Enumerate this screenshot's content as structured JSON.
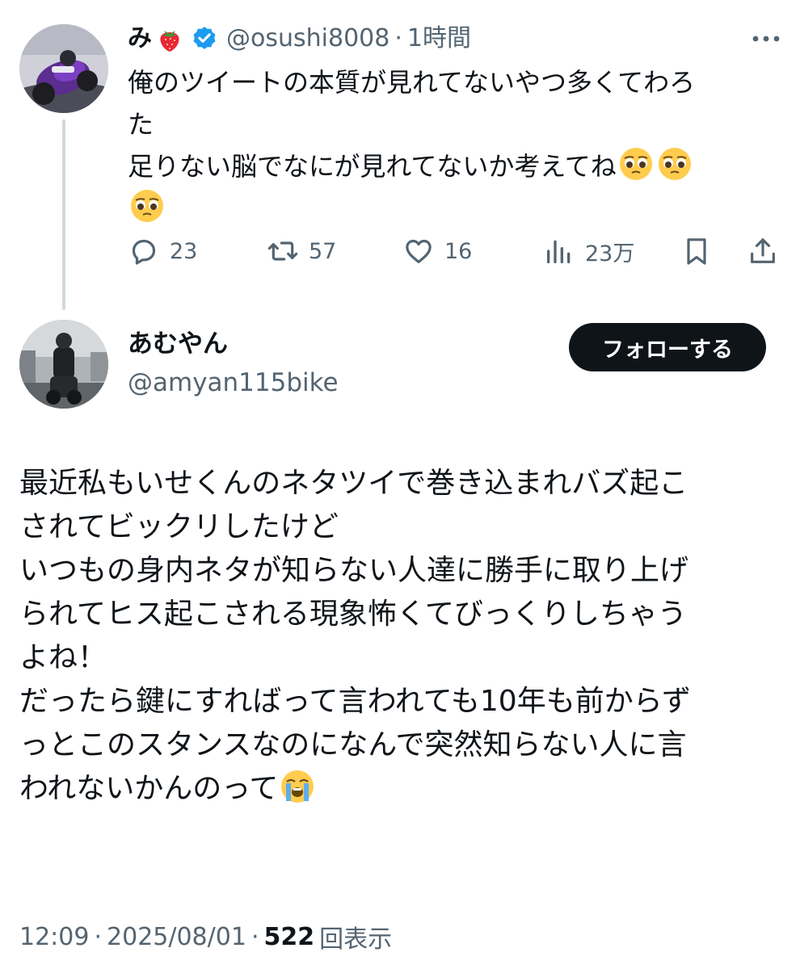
{
  "parent_tweet": {
    "author_name": "み",
    "name_emoji": "strawberry-emoji",
    "verified": true,
    "handle": "@osushi8008",
    "separator": "·",
    "time": "1時間",
    "body_lines": [
      "俺のツイートの本質が見れてないやつ多くてわろ",
      "た",
      "足りない脳でなにが見れてないか考えてね"
    ],
    "body_emoji": "pleading-face-emoji",
    "actions": {
      "reply_count": "23",
      "retweet_count": "57",
      "like_count": "16",
      "view_count": "23万"
    }
  },
  "reply_tweet": {
    "author_name": "あむやん",
    "handle": "@amyan115bike",
    "follow_label": "フォローする",
    "body_lines": [
      "最近私もいせくんのネタツイで巻き込まれバズ起こ",
      "されてビックリしたけど",
      "いつもの身内ネタが知らない人達に勝手に取り上げ",
      "られてヒス起こされる現象怖くてびっくりしちゃう",
      "よね！",
      "だったら鍵にすればって言われても10年も前からず",
      "っとこのスタンスなのになんで突然知らない人に言",
      "われないかんのって"
    ],
    "end_emoji": "loudly-crying-face-emoji",
    "meta": {
      "time": "12:09",
      "separator": "·",
      "date": "2025/08/01",
      "views": "522",
      "views_label": "回表示"
    }
  },
  "colors": {
    "text": "#0f1419",
    "secondary": "#536471",
    "verified_blue": "#1d9bf0",
    "thread_line": "#cfd9de",
    "follow_bg": "#0f1419"
  }
}
